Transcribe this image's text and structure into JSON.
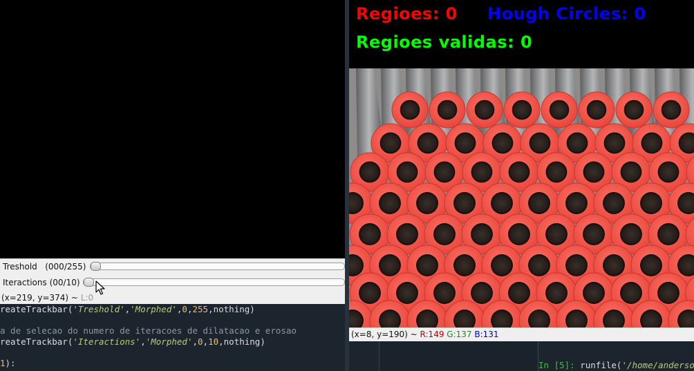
{
  "morphed_window": {
    "trackbars": [
      {
        "label": "Treshold",
        "value_text": "(000/255)",
        "value": 0,
        "max": 255
      },
      {
        "label": "Iteractions",
        "value_text": "(00/10)",
        "value": 0,
        "max": 10
      }
    ],
    "status": {
      "coords": "(x=219, y=374) ~",
      "level": "L:0"
    }
  },
  "editor": {
    "lines": [
      {
        "prefix": "reateTrackbar(",
        "arg1": "'Treshold'",
        "comma1": ",",
        "arg2": "'Morphed'",
        "comma2": ",",
        "n1": "0",
        "comma3": ",",
        "n2": "255",
        "suffix": ",nothing)"
      },
      {
        "comment": "a de selecao do numero de iteracoes de dilatacao e erosao"
      },
      {
        "prefix": "reateTrackbar(",
        "arg1": "'Iteractions'",
        "comma1": ",",
        "arg2": "'Morphed'",
        "comma2": ",",
        "n1": "0",
        "comma3": ",",
        "n2": "10",
        "suffix": ",nothing)"
      },
      {
        "n": "1",
        "suffix": "):"
      }
    ]
  },
  "console": {
    "prompt": "In [",
    "number": "5",
    "prompt_end": "]:",
    "command": " runfile(",
    "path": "'/home/anderso"
  },
  "result_window": {
    "overlays": {
      "regions": {
        "text": "Regioes: 0",
        "color": "#ff0000"
      },
      "hough": {
        "text": "Hough Circles: 0",
        "color": "#0000ff"
      },
      "valid": {
        "text": "Regioes validas: 0",
        "color": "#00ff00"
      }
    },
    "status": {
      "coords": "(x=8, y=190) ~",
      "r": "R:149",
      "g": "G:137",
      "b": "B:131"
    }
  }
}
